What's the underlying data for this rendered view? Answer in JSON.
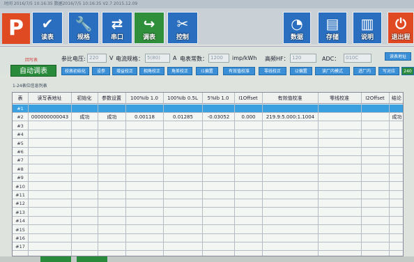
{
  "titlebar": {
    "text": "时间  2016/7/5 10:16:35  数据2016/7/5 10:16:35  V2.7 2015.12.09"
  },
  "toolbar": {
    "p_label": "P",
    "buttons": [
      {
        "label": "读表",
        "icon": "check-icon",
        "glyph": "✔",
        "color": "#2a6fbf"
      },
      {
        "label": "规格",
        "icon": "wrench-icon",
        "glyph": "🔧",
        "color": "#2a6fbf"
      },
      {
        "label": "串口",
        "icon": "usb-icon",
        "glyph": "⇄",
        "color": "#2a6fbf"
      },
      {
        "label": "调表",
        "icon": "enter-icon",
        "glyph": "↪",
        "color": "#2f8f3a"
      },
      {
        "label": "控制",
        "icon": "tools-icon",
        "glyph": "✂",
        "color": "#2a6fbf"
      },
      {
        "label": "数据",
        "icon": "pie-icon",
        "glyph": "◔",
        "color": "#2a6fbf"
      },
      {
        "label": "存储",
        "icon": "save-icon",
        "glyph": "▤",
        "color": "#2a6fbf"
      },
      {
        "label": "说明",
        "icon": "book-icon",
        "glyph": "▥",
        "color": "#2a6fbf"
      },
      {
        "label": "退出程",
        "icon": "power-icon",
        "glyph": "⏻",
        "color": "#e04a23"
      }
    ]
  },
  "info": {
    "status": "回写表",
    "voltage_label": "参比电压:",
    "voltage_value": "220",
    "voltage_unit": "V",
    "current_label": "电流规格：",
    "current_value": "5(80)",
    "current_unit": "A",
    "const_label": "电表常数：",
    "const_value": "1200",
    "const_unit": "imp/kWh",
    "hf_label": "高频HF：",
    "hf_value": "120",
    "adc_label": "ADC：",
    "adc_value": "010C",
    "read_addr": "读表地址"
  },
  "auto_label": "自动调表",
  "mode_buttons": [
    "校表初始化",
    "设参",
    "增益校正",
    "相角校正",
    "角差校正",
    "I1偏置",
    "有效值校准",
    "零线校正",
    "I2偏置",
    "读厂内模式",
    "进厂内",
    "写对应"
  ],
  "mode_extra": "240",
  "caption": "1-24表位信息列表",
  "table": {
    "headers": [
      "表",
      "读写表地址",
      "初始化",
      "参数设置",
      "100%Ib 1.0",
      "100%Ib 0.5L",
      "5%Ib 1.0",
      "I1Offset",
      "有效值校准",
      "零线校准",
      "I2Offset",
      "结论"
    ],
    "rows": [
      {
        "id": "#1",
        "cells": [
          "",
          "",
          "",
          "",
          "",
          "",
          "",
          "",
          "",
          "",
          ""
        ]
      },
      {
        "id": "#2",
        "cells": [
          "000000000043",
          "成功",
          "成功",
          "0.00118",
          "0.01285",
          "-0.03052",
          "0.000",
          "219.9:5.000:1.1004",
          "",
          "",
          "成功"
        ]
      },
      {
        "id": "#3",
        "cells": []
      },
      {
        "id": "#4",
        "cells": []
      },
      {
        "id": "#5",
        "cells": []
      },
      {
        "id": "#6",
        "cells": []
      },
      {
        "id": "#7",
        "cells": []
      },
      {
        "id": "#8",
        "cells": []
      },
      {
        "id": "#9",
        "cells": []
      },
      {
        "id": "#10",
        "cells": []
      },
      {
        "id": "#11",
        "cells": []
      },
      {
        "id": "#12",
        "cells": []
      },
      {
        "id": "#13",
        "cells": []
      },
      {
        "id": "#14",
        "cells": []
      },
      {
        "id": "#15",
        "cells": []
      },
      {
        "id": "#16",
        "cells": []
      },
      {
        "id": "#17",
        "cells": []
      }
    ]
  }
}
